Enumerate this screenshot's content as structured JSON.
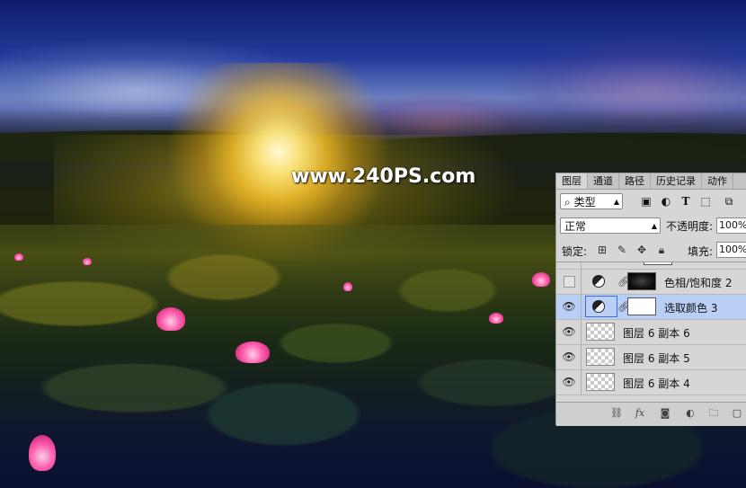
{
  "watermark": "www.240PS.com",
  "panel": {
    "tabs": [
      {
        "label": "图层",
        "active": true
      },
      {
        "label": "通道",
        "active": false
      },
      {
        "label": "路径",
        "active": false
      },
      {
        "label": "历史记录",
        "active": false
      },
      {
        "label": "动作",
        "active": false
      }
    ],
    "filter": {
      "search_icon": "⌕",
      "label": "类型",
      "icons": [
        "image-icon",
        "adjustment-icon",
        "type-icon",
        "shape-icon",
        "smart-object-icon"
      ]
    },
    "blend_mode": "正常",
    "opacity_label": "不透明度:",
    "opacity_value": "100%",
    "lock_label": "锁定:",
    "fill_label": "填充:",
    "fill_value": "100%",
    "layers": [
      {
        "name": "色相/饱和度 2",
        "visible": false,
        "type": "adjustment",
        "mask": "dark",
        "selected": false
      },
      {
        "name": "选取颜色 3",
        "visible": true,
        "type": "adjustment",
        "mask": "white",
        "selected": true
      },
      {
        "name": "图层 6 副本 6",
        "visible": true,
        "type": "pixel",
        "selected": false
      },
      {
        "name": "图层 6 副本 5",
        "visible": true,
        "type": "pixel",
        "selected": false
      },
      {
        "name": "图层 6 副本 4",
        "visible": true,
        "type": "pixel",
        "selected": false
      }
    ],
    "footer_icons": [
      "link-icon",
      "fx-icon",
      "mask-icon",
      "adjustment-layer-icon",
      "folder-icon",
      "new-layer-icon"
    ]
  },
  "colors": {
    "selected_row": "#b9cff5",
    "panel_bg": "#d6d6d6"
  }
}
